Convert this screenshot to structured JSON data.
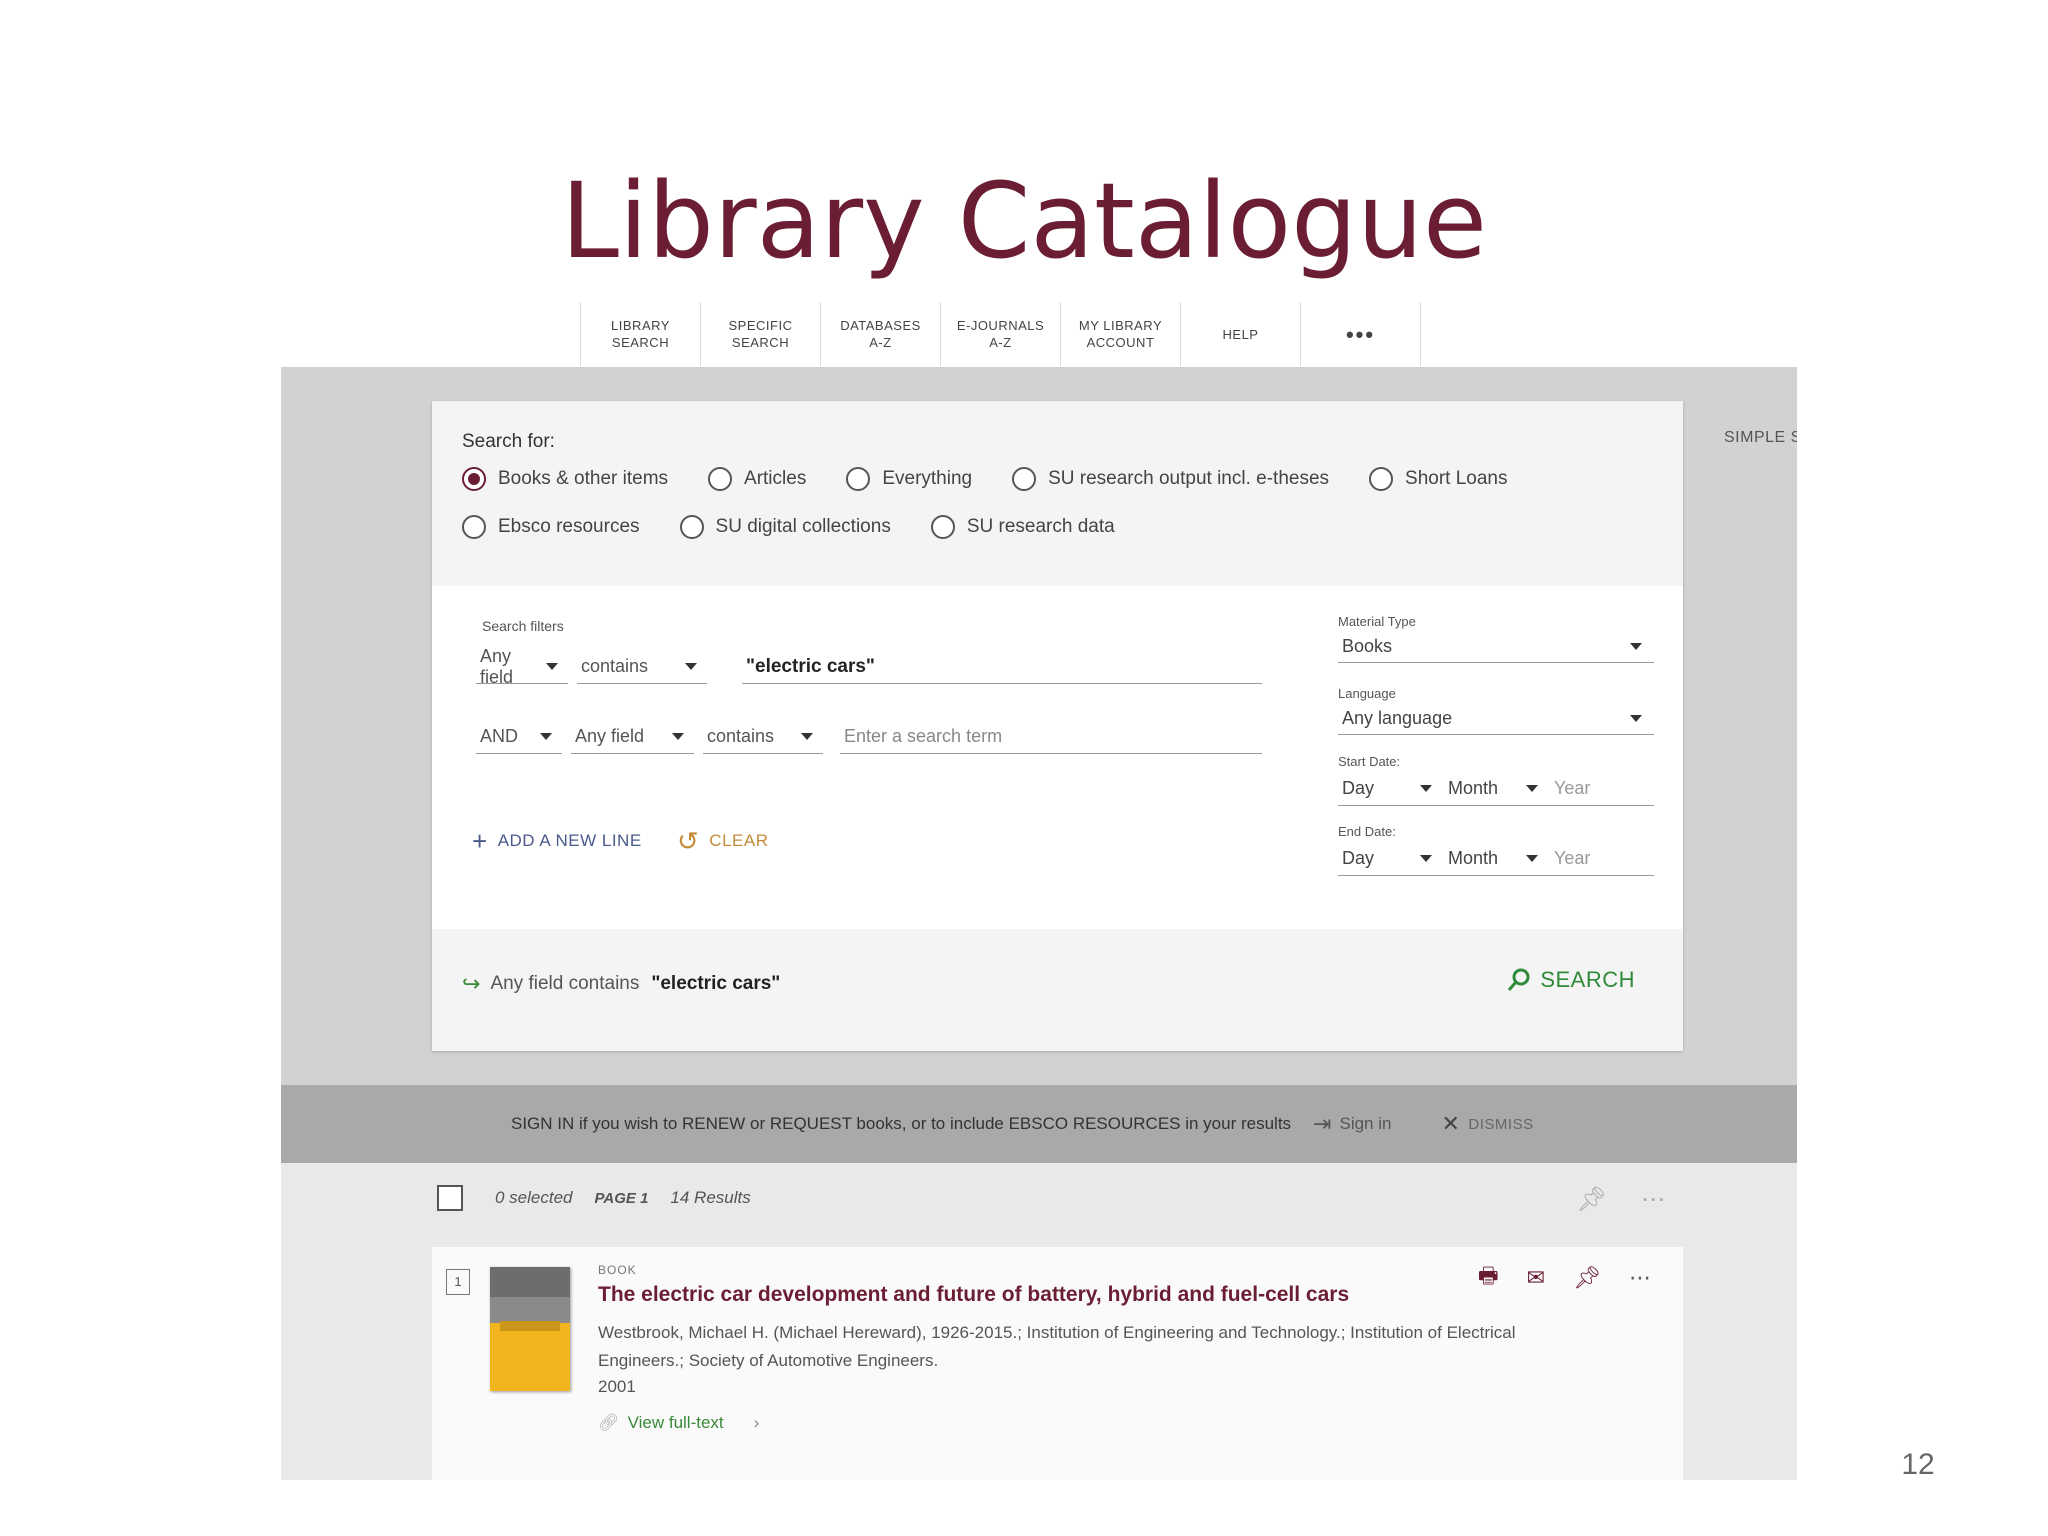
{
  "slide": {
    "title": "Library Catalogue",
    "page_number": "12"
  },
  "nav": {
    "items": [
      {
        "label": "LIBRARY\nSEARCH"
      },
      {
        "label": "SPECIFIC\nSEARCH"
      },
      {
        "label": "DATABASES\nA-Z"
      },
      {
        "label": "E-JOURNALS\nA-Z"
      },
      {
        "label": "MY LIBRARY\nACCOUNT"
      },
      {
        "label": "HELP"
      },
      {
        "label": "•••"
      }
    ]
  },
  "simple_search_label": "SIMPLE S",
  "search": {
    "search_for_label": "Search for:",
    "options_row1": [
      "Books & other items",
      "Articles",
      "Everything",
      "SU research output incl. e-theses",
      "Short Loans"
    ],
    "options_row2": [
      "Ebsco resources",
      "SU digital collections",
      "SU research data"
    ],
    "selected_option": "Books & other items",
    "filters_label": "Search filters",
    "line1": {
      "field": "Any field",
      "operator": "contains",
      "term": "\"electric cars\""
    },
    "line2": {
      "boolean": "AND",
      "field": "Any field",
      "operator": "contains",
      "placeholder": "Enter a search term"
    },
    "add_line_label": "ADD A NEW LINE",
    "clear_label": "CLEAR",
    "material_type_label": "Material Type",
    "material_type_value": "Books",
    "language_label": "Language",
    "language_value": "Any language",
    "start_date_label": "Start Date:",
    "end_date_label": "End Date:",
    "day_label": "Day",
    "month_label": "Month",
    "year_placeholder": "Year",
    "summary_prefix": "Any field  contains",
    "summary_value": "\"electric cars\"",
    "search_button_label": "SEARCH"
  },
  "signin_bar": {
    "message": "SIGN IN if you wish to RENEW or REQUEST books, or to include EBSCO RESOURCES in your results",
    "signin_label": "Sign in",
    "dismiss_label": "DISMISS"
  },
  "results": {
    "selected_text": "0 selected",
    "page_text": "PAGE 1",
    "count_text": "14 Results",
    "record": {
      "number": "1",
      "type": "BOOK",
      "title": "The electric car development and future of battery, hybrid and fuel-cell cars",
      "authors": "Westbrook, Michael H. (Michael Hereward), 1926-2015.; Institution of Engineering and Technology.; Institution of Electrical Engineers.; Society of Automotive Engineers.",
      "year": "2001",
      "fulltext_label": "View full-text"
    }
  },
  "colors": {
    "brand": "#6b1e33",
    "search_green": "#2f8a3a",
    "clear_orange": "#c48a3a"
  }
}
